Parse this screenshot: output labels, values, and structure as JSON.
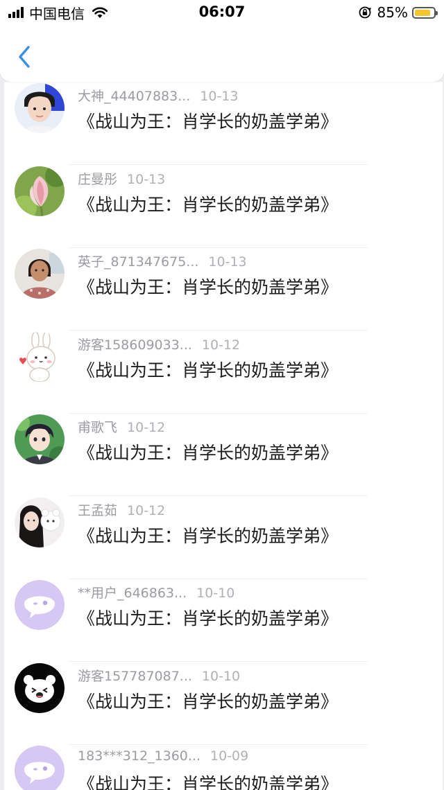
{
  "status_bar": {
    "carrier": "中国电信",
    "time": "06:07",
    "battery_pct": "85%",
    "battery_level": 0.85,
    "battery_color": "#f5c531"
  },
  "nav": {
    "back_icon": "chevron-left-icon",
    "accent": "#3b8ee8"
  },
  "comments": [
    {
      "user": "大神_44407883...",
      "date": "10-13",
      "book": "《战山为王：肖学长的奶盖学弟》",
      "avatar": "boy-portrait"
    },
    {
      "user": "庄曼彤",
      "date": "10-13",
      "book": "《战山为王：肖学长的奶盖学弟》",
      "avatar": "lotus"
    },
    {
      "user": "英子_871347675...",
      "date": "10-13",
      "book": "《战山为王：肖学长的奶盖学弟》",
      "avatar": "woman-photo"
    },
    {
      "user": "游客158609033...",
      "date": "10-12",
      "book": "《战山为王：肖学长的奶盖学弟》",
      "avatar": "bunny-sticker"
    },
    {
      "user": "甫歌飞",
      "date": "10-12",
      "book": "《战山为王：肖学长的奶盖学弟》",
      "avatar": "anime-boy"
    },
    {
      "user": "王孟茹",
      "date": "10-12",
      "book": "《战山为王：肖学长的奶盖学弟》",
      "avatar": "girl-with-plush"
    },
    {
      "user": "**用户_646863...",
      "date": "10-10",
      "book": "《战山为王：肖学长的奶盖学弟》",
      "avatar": "default-chat-bubble"
    },
    {
      "user": "游客157787087...",
      "date": "10-10",
      "book": "《战山为王：肖学长的奶盖学弟》",
      "avatar": "bear-emoji"
    },
    {
      "user": "183***312_1360...",
      "date": "10-09",
      "book": "《战山为王：肖学长的奶盖学弟》",
      "avatar": "default-chat-bubble"
    }
  ]
}
